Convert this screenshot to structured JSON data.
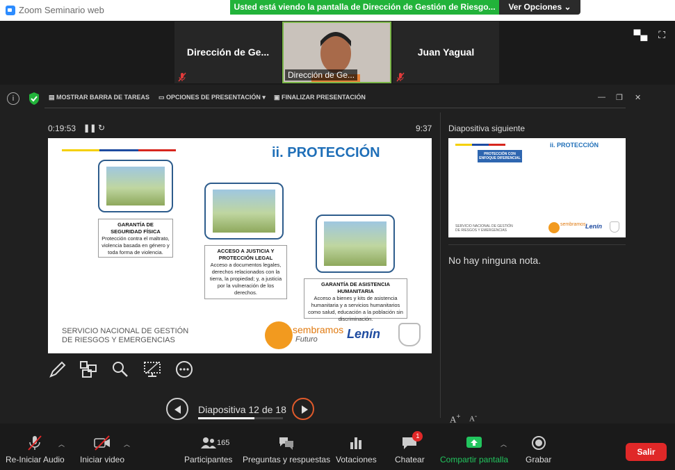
{
  "window": {
    "title": "Zoom Seminario web"
  },
  "share_banner": {
    "text": "Usted está viendo la pantalla de Dirección de Gestión de Riesgo...",
    "view_options": "Ver Opciones ⌄"
  },
  "participants_strip": {
    "left_name": "Dirección de Ge...",
    "video_name": "Dirección de Ge...",
    "right_name": "Juan Yagual"
  },
  "presenter_toolbar": {
    "taskbar": "MOSTRAR BARRA DE TAREAS",
    "options": "OPCIONES DE PRESENTACIÓN ▾",
    "end": "FINALIZAR PRESENTACIÓN"
  },
  "presenter": {
    "elapsed": "0:19:53",
    "clock": "9:37",
    "next_label": "Diapositiva siguiente",
    "notes": "No hay ninguna nota.",
    "counter": "Diapositiva 12 de 18",
    "progress_fraction": 0.667
  },
  "slide": {
    "title": "ii. PROTECCIÓN",
    "cards": [
      {
        "heading": "GARANTÍA DE SEGURIDAD FÍSICA",
        "body": "Protección contra el maltrato, violencia basada en género y toda forma de violencia."
      },
      {
        "heading": "ACCESO A JUSTICIA Y PROTECCIÓN LEGAL",
        "body": "Acceso a documentos legales, derechos relacionados con la tierra, la propiedad; y, a justicia por la vulneración de los derechos."
      },
      {
        "heading": "GARANTÍA DE ASISTENCIA HUMANITARIA",
        "body": "Acceso a bienes y kits de asistencia humanitaria y a servicios humanitarios como salud, educación a la población sin discriminación."
      }
    ],
    "org_line1": "SERVICIO NACIONAL DE GESTIÓN",
    "org_line2": "DE RIESGOS Y EMERGENCIAS",
    "logo_text": "sembramos",
    "logo_sub": "Futuro",
    "signature": "Lenín"
  },
  "next_slide": {
    "title": "ii. PROTECCIÓN",
    "box": "PROTECCIÓN CON ENFOQUE DIFERENCIAL",
    "org_line1": "SERVICIO NACIONAL DE GESTIÓN",
    "org_line2": "DE RIESGOS Y EMERGENCIAS"
  },
  "controls": {
    "audio": "Re-Iniciar Audio",
    "video": "Iniciar video",
    "participants": "Participantes",
    "participants_count": "165",
    "qa": "Preguntas y respuestas",
    "polls": "Votaciones",
    "chat": "Chatear",
    "chat_badge": "1",
    "share": "Compartir pantalla",
    "record": "Grabar",
    "leave": "Salir"
  },
  "colors": {
    "banner": "#22b33a",
    "leave": "#e02828",
    "share": "#22c55e",
    "slide_title": "#1f6fb8"
  }
}
